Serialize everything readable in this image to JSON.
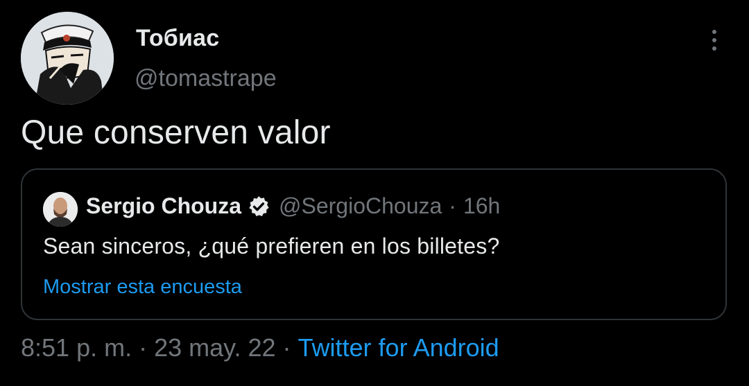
{
  "tweet": {
    "author": {
      "display_name": "Тобиас",
      "handle": "@tomastrape"
    },
    "text": "Que conserven valor",
    "meta": {
      "time": "8:51 p. m.",
      "separator": "·",
      "date": "23 may. 22",
      "source": "Twitter for Android"
    }
  },
  "quoted_tweet": {
    "author": {
      "display_name": "Sergio Chouza",
      "handle": "@SergioChouza",
      "verified": true
    },
    "separator": "·",
    "time": "16h",
    "text": "Sean sinceros, ¿qué prefieren en los billetes?",
    "poll_link": "Mostrar esta encuesta"
  },
  "icons": {
    "more": "more-vertical-icon",
    "verified": "verified-badge-icon"
  },
  "colors": {
    "background": "#000000",
    "text_primary": "#e7e9ea",
    "text_secondary": "#71767b",
    "link": "#1d9bf0",
    "border": "#2f3336"
  }
}
